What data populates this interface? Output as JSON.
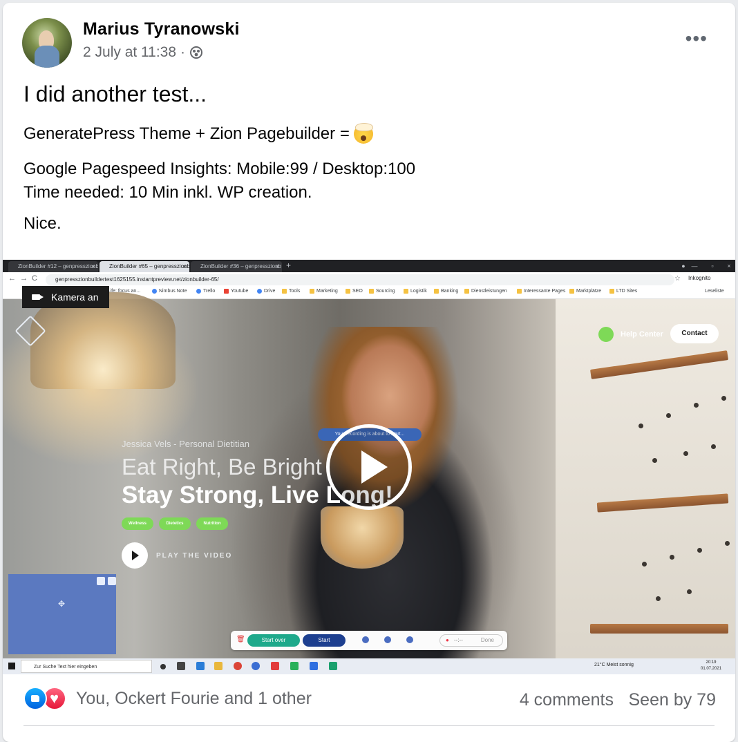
{
  "post": {
    "author": "Marius Tyranowski",
    "timestamp": "2 July at 11:38",
    "separator": "·",
    "audience_icon": "friends-icon",
    "more_label": "•••",
    "text_line1": "I did another test...",
    "text_line2": "GeneratePress Theme + Zion Pagebuilder =",
    "text_line2_emoji": "exploding-head-emoji",
    "text_line3": "Google Pagespeed Insights: Mobile:99 / Desktop:100",
    "text_line4": "Time needed: 10 Min inkl. WP creation.",
    "text_line5": "Nice."
  },
  "video": {
    "tabs": [
      {
        "label": "ZionBuilder #12 – genpresszionb"
      },
      {
        "label": "ZionBuilder #65 – genpresszionb"
      },
      {
        "label": "ZionBuilder #36 – genpresszionb"
      }
    ],
    "new_tab": "+",
    "url": "genpresszionbuildertest1625155.instantpreview.net/zionbuilder-65/",
    "incognito": "Inkognito",
    "bookmarks": [
      "ma Life: focus an...",
      "Nimbus Note",
      "Trello",
      "Youtube",
      "Drive",
      "Tools",
      "Marketing",
      "SEO",
      "Sourcing",
      "Logistik",
      "Banking",
      "Dienstleistungen",
      "Interessante Pages",
      "Marktplätze",
      "LTD Sites",
      "Leseliste"
    ],
    "camera_label": "Kamera an",
    "site": {
      "help_center": "Help Center",
      "contact": "Contact",
      "subtitle": "Jessica Vels - Personal Dietitian",
      "headline1": "Eat Right, Be Bright",
      "headline2": "Stay Strong, Live Long!",
      "chips": [
        "Wellness",
        "Dietetics",
        "Nutrition"
      ],
      "play_label": "PLAY THE VIDEO"
    },
    "recording_notice": "Your recording is about to start...",
    "recorder": {
      "start_over": "Start over",
      "start": "Start",
      "timer": "--:--",
      "done": "Done"
    },
    "taskbar": {
      "search_placeholder": "Zur Suche Text hier eingeben",
      "weather": "21°C  Meist sonnig",
      "time": "20:19",
      "date": "01.07.2021"
    }
  },
  "footer": {
    "reactions_text": "You, Ockert Fourie and 1 other",
    "comments": "4 comments",
    "seen_by": "Seen by 79",
    "colors": {
      "like": "#1877f2",
      "love": "#f33e58"
    }
  }
}
